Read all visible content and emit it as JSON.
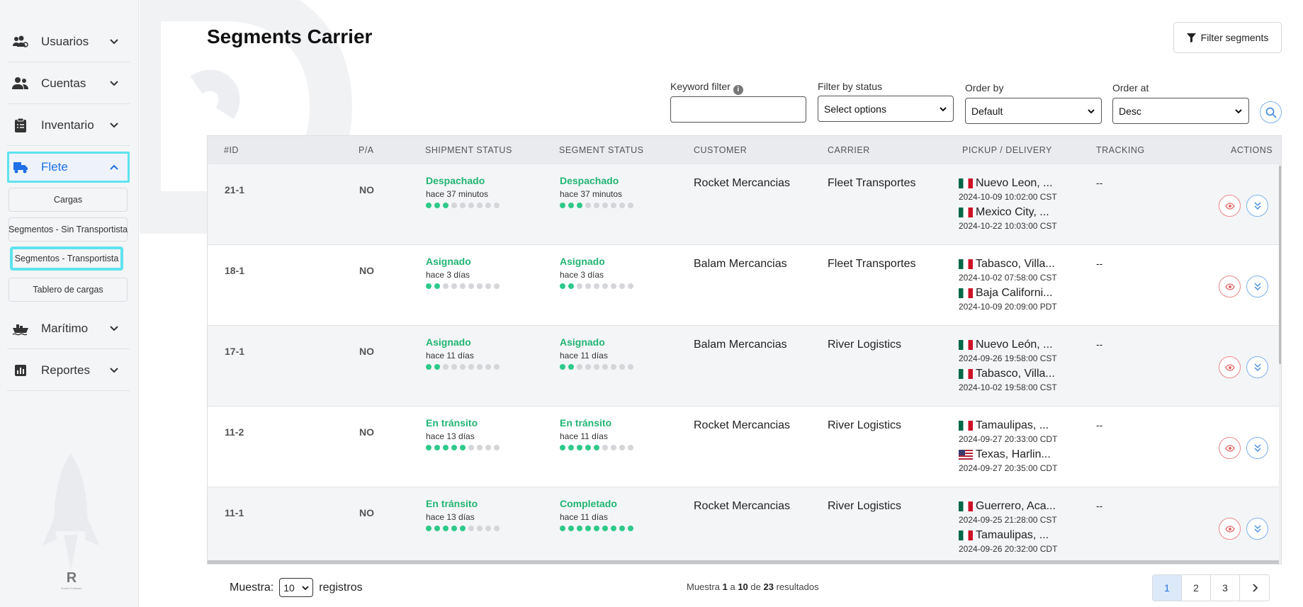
{
  "sidebar": {
    "items": [
      {
        "label": "Usuarios",
        "icon": "users-cog-icon"
      },
      {
        "label": "Cuentas",
        "icon": "user-group-icon"
      },
      {
        "label": "Inventario",
        "icon": "clipboard-icon"
      },
      {
        "label": "Flete",
        "icon": "truck-icon"
      },
      {
        "label": "Marítimo",
        "icon": "ship-icon"
      },
      {
        "label": "Reportes",
        "icon": "chart-icon"
      }
    ],
    "flete_sub": [
      "Cargas",
      "Segmentos - Sin Transportista",
      "Segmentos - Transportista",
      "Tablero de cargas"
    ],
    "brand": "R",
    "brand_tag": "Rocket Software"
  },
  "header": {
    "title": "Segments Carrier",
    "filter_button": "Filter segments"
  },
  "filters": {
    "keyword_label": "Keyword filter",
    "keyword_value": "",
    "status_label": "Filter by status",
    "status_value": "Select options",
    "order_by_label": "Order by",
    "order_by_value": "Default",
    "order_at_label": "Order at",
    "order_at_value": "Desc"
  },
  "table": {
    "headers": [
      "#ID",
      "P/A",
      "SHIPMENT STATUS",
      "SEGMENT STATUS",
      "CUSTOMER",
      "CARRIER",
      "PICKUP / DELIVERY",
      "TRACKING",
      "ACTIONS"
    ],
    "rows": [
      {
        "id": "21-1",
        "pa": "NO",
        "ship_status": "Despachado",
        "ship_time": "hace 37 minutos",
        "ship_progress": 3,
        "seg_status": "Despachado",
        "seg_time": "hace 37 minutos",
        "seg_progress": 3,
        "customer": "Rocket Mercancias",
        "carrier": "Fleet Transportes",
        "pickup": "Nuevo Leon, ...",
        "pickup_flag": "mx",
        "pickup_date": "2024-10-09 10:02:00 CST",
        "delivery": "Mexico City, ...",
        "delivery_flag": "mx",
        "delivery_date": "2024-10-22 10:03:00 CST",
        "tracking": "--"
      },
      {
        "id": "18-1",
        "pa": "NO",
        "ship_status": "Asignado",
        "ship_time": "hace 3 días",
        "ship_progress": 2,
        "seg_status": "Asignado",
        "seg_time": "hace 3 días",
        "seg_progress": 2,
        "customer": "Balam Mercancias",
        "carrier": "Fleet Transportes",
        "pickup": "Tabasco, Villa...",
        "pickup_flag": "mx",
        "pickup_date": "2024-10-02 07:58:00 CST",
        "delivery": "Baja Californi...",
        "delivery_flag": "mx",
        "delivery_date": "2024-10-09 20:09:00 PDT",
        "tracking": "--"
      },
      {
        "id": "17-1",
        "pa": "NO",
        "ship_status": "Asignado",
        "ship_time": "hace 11 días",
        "ship_progress": 2,
        "seg_status": "Asignado",
        "seg_time": "hace 11 días",
        "seg_progress": 2,
        "customer": "Balam Mercancias",
        "carrier": "River Logistics",
        "pickup": "Nuevo León, ...",
        "pickup_flag": "mx",
        "pickup_date": "2024-09-26 19:58:00 CST",
        "delivery": "Tabasco, Villa...",
        "delivery_flag": "mx",
        "delivery_date": "2024-10-02 19:58:00 CST",
        "tracking": "--"
      },
      {
        "id": "11-2",
        "pa": "NO",
        "ship_status": "En tránsito",
        "ship_time": "hace 13 días",
        "ship_progress": 5,
        "seg_status": "En tránsito",
        "seg_time": "hace 11 días",
        "seg_progress": 5,
        "customer": "Rocket Mercancias",
        "carrier": "River Logistics",
        "pickup": "Tamaulipas, ...",
        "pickup_flag": "mx",
        "pickup_date": "2024-09-27 20:33:00 CDT",
        "delivery": "Texas, Harlin...",
        "delivery_flag": "us",
        "delivery_date": "2024-09-27 20:35:00 CDT",
        "tracking": "--"
      },
      {
        "id": "11-1",
        "pa": "NO",
        "ship_status": "En tránsito",
        "ship_time": "hace 13 días",
        "ship_progress": 5,
        "seg_status": "Completado",
        "seg_time": "hace 11 días",
        "seg_progress": 9,
        "customer": "Rocket Mercancias",
        "carrier": "River Logistics",
        "pickup": "Guerrero, Aca...",
        "pickup_flag": "mx",
        "pickup_date": "2024-09-25 21:28:00 CST",
        "delivery": "Tamaulipas, ...",
        "delivery_flag": "mx",
        "delivery_date": "2024-09-26 20:32:00 CDT",
        "tracking": "--"
      }
    ]
  },
  "footer": {
    "show_label": "Muestra:",
    "page_size": "10",
    "records_label": "registros",
    "summary_prefix": "Muestra",
    "from": "1",
    "sep_a": "a",
    "to": "10",
    "sep_de": "de",
    "total": "23",
    "summary_suffix": "resultados",
    "pages": [
      "1",
      "2",
      "3"
    ],
    "current_page": "1"
  },
  "colors": {
    "accent": "#1f6fe5",
    "highlight": "#5ee3ee",
    "status_green": "#22b573",
    "dot_off": "#d4d6d9"
  }
}
